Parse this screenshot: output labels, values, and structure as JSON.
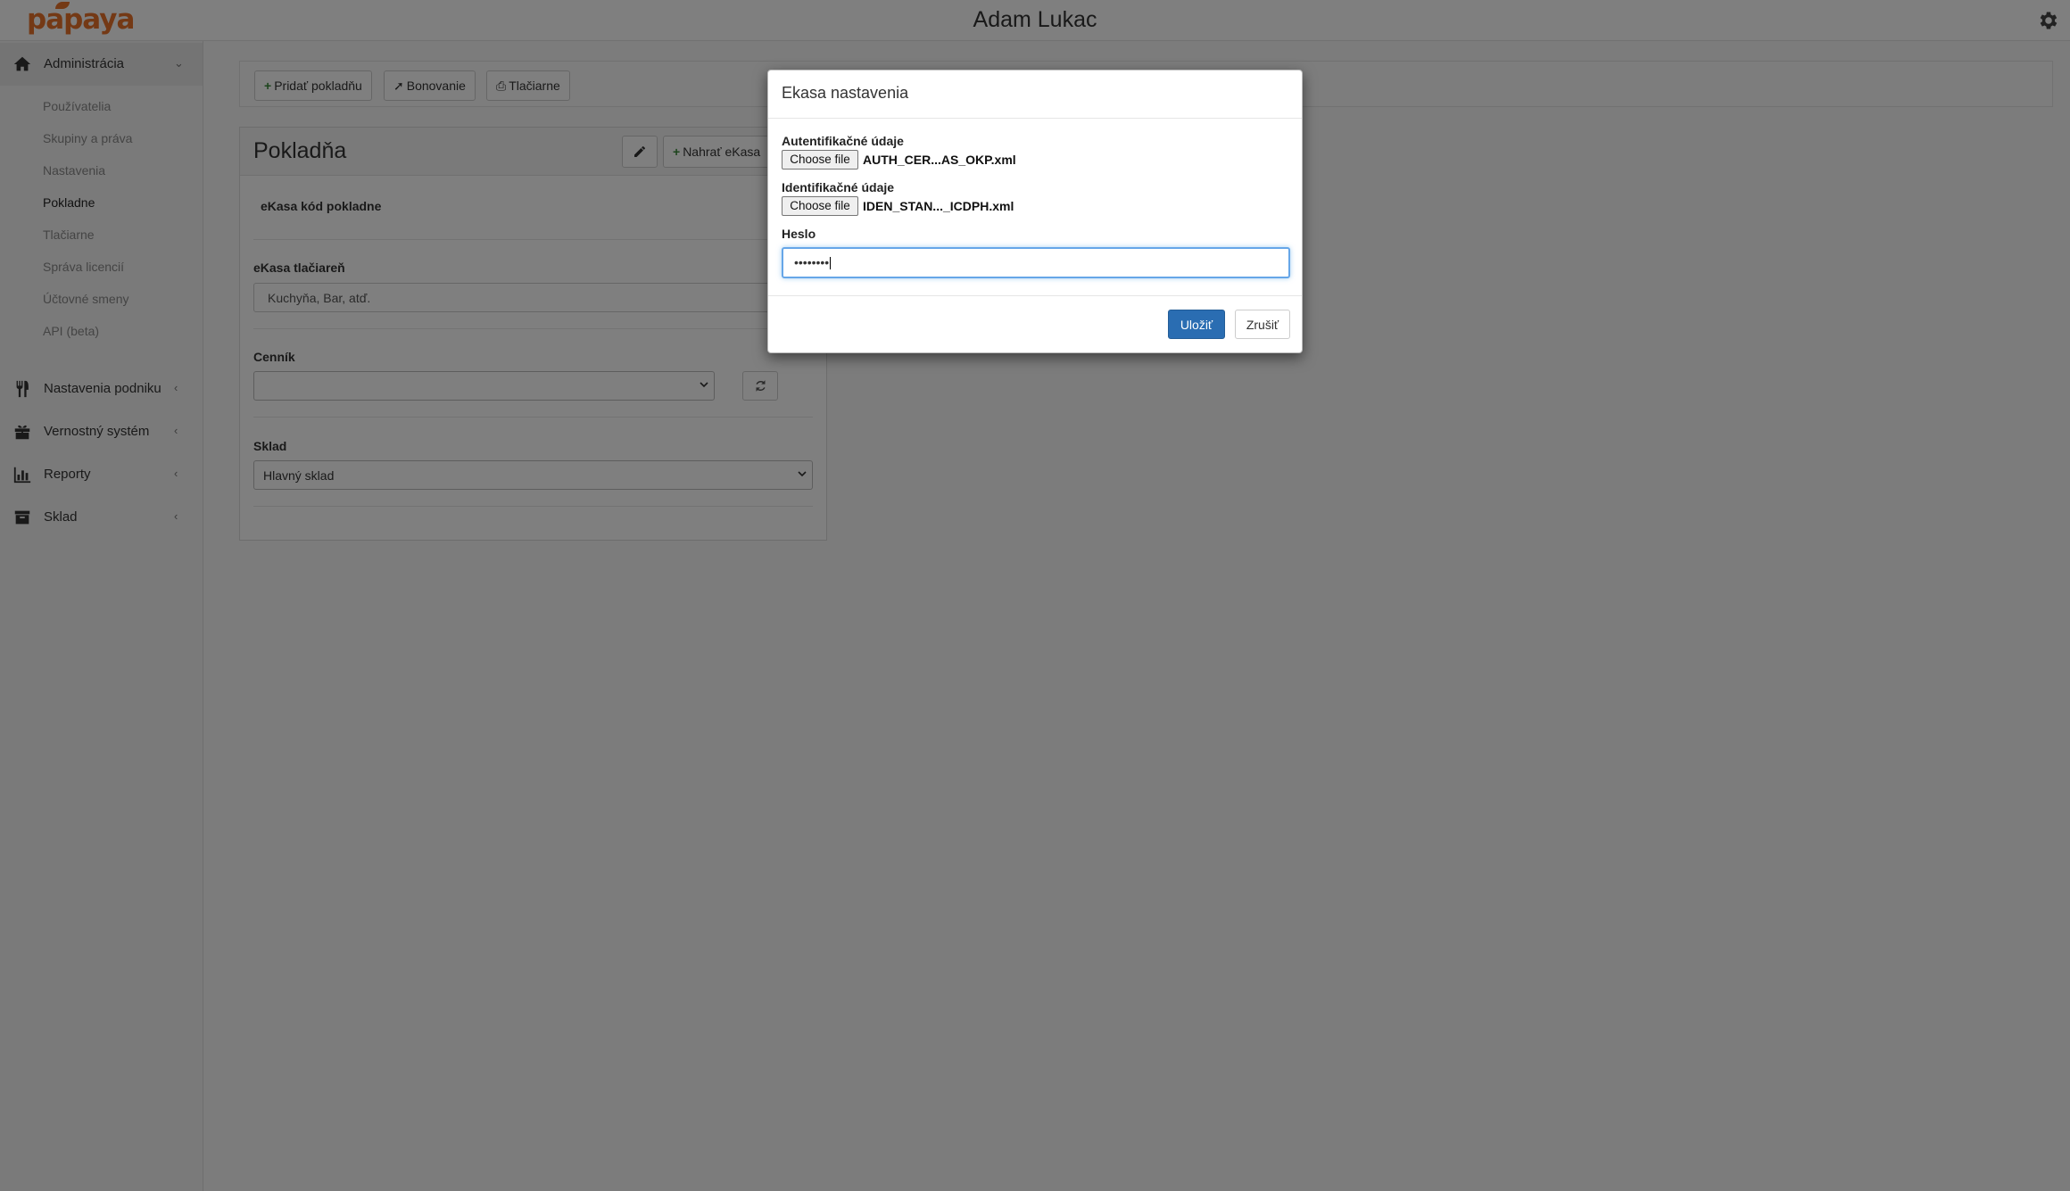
{
  "header": {
    "logo_text": "papaya",
    "user_name": "Adam Lukac",
    "settings_icon": "gear-icon"
  },
  "sidebar": {
    "sections": [
      {
        "label": "Administrácia",
        "icon": "home-icon",
        "expanded": true
      },
      {
        "label": "Nastavenia podniku",
        "icon": "cutlery-icon",
        "expanded": false
      },
      {
        "label": "Vernostný systém",
        "icon": "gift-icon",
        "expanded": false
      },
      {
        "label": "Reporty",
        "icon": "bar-chart-icon",
        "expanded": false
      },
      {
        "label": "Sklad",
        "icon": "archive-icon",
        "expanded": false
      }
    ],
    "admin_items": [
      {
        "label": "Používatelia"
      },
      {
        "label": "Skupiny a práva"
      },
      {
        "label": "Nastavenia"
      },
      {
        "label": "Pokladne",
        "current": true
      },
      {
        "label": "Tlačiarne"
      },
      {
        "label": "Správa licencií"
      },
      {
        "label": "Účtovné smeny"
      },
      {
        "label": "API (beta)"
      }
    ]
  },
  "toolbar": {
    "add_register": "Pridať pokladňu",
    "bonovanie": "Bonovanie",
    "printers": "Tlačiarne"
  },
  "card": {
    "title": "Pokladňa",
    "upload_label": "Nahrať eKasa",
    "ekasa_code_label": "eKasa kód pokladne",
    "ekasa_printer_label": "eKasa tlačiareň",
    "ekasa_printer_placeholder": "Kuchyňa, Bar, atď.",
    "pricelist_label": "Cenník",
    "pricelist_value": "",
    "warehouse_label": "Sklad",
    "warehouse_value": "Hlavný sklad"
  },
  "modal": {
    "title": "Ekasa nastavenia",
    "auth_label": "Autentifikačné údaje",
    "auth_button": "Choose file",
    "auth_file": "AUTH_CER...AS_OKP.xml",
    "ident_label": "Identifikačné údaje",
    "ident_button": "Choose file",
    "ident_file": "IDEN_STAN..._ICDPH.xml",
    "password_label": "Heslo",
    "password_value": "••••••••",
    "save": "Uložiť",
    "cancel": "Zrušiť"
  },
  "colors": {
    "brand": "#e8722a",
    "primary": "#2a6db2",
    "focus": "#66a6e8"
  }
}
